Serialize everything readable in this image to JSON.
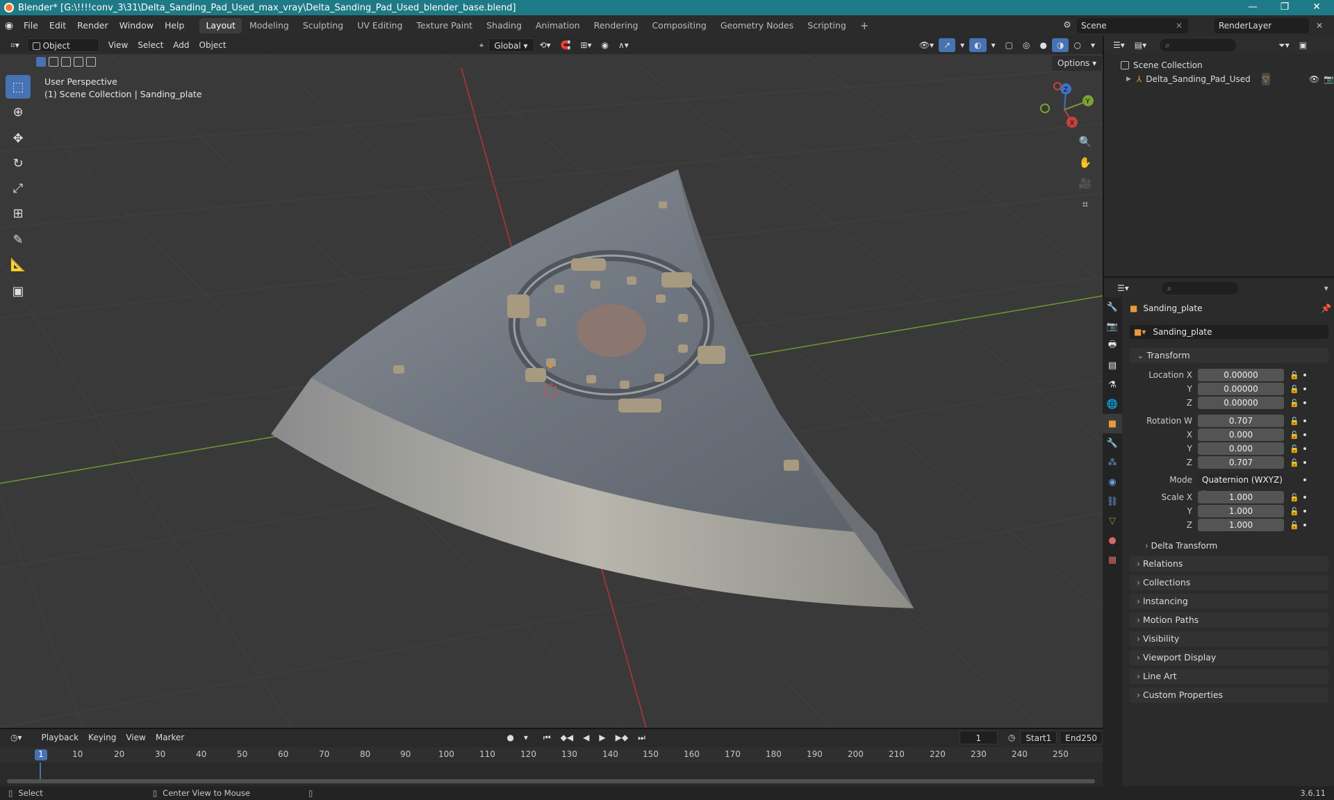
{
  "window": {
    "title": "Blender* [G:\\!!!!conv_3\\31\\Delta_Sanding_Pad_Used_max_vray\\Delta_Sanding_Pad_Used_blender_base.blend]",
    "controls": [
      "—",
      "❐",
      "✕"
    ]
  },
  "menu": [
    "File",
    "Edit",
    "Render",
    "Window",
    "Help"
  ],
  "workspaces": [
    "Layout",
    "Modeling",
    "Sculpting",
    "UV Editing",
    "Texture Paint",
    "Shading",
    "Animation",
    "Rendering",
    "Compositing",
    "Geometry Nodes",
    "Scripting"
  ],
  "active_workspace": "Layout",
  "scene_name": "Scene",
  "view_layer": "RenderLayer",
  "viewport_header": {
    "mode": "Object Mode",
    "menus": [
      "View",
      "Select",
      "Add",
      "Object"
    ],
    "orientation": "Global",
    "options_label": "Options"
  },
  "viewport": {
    "perspective": "User Perspective",
    "collection_info": "(1) Scene Collection | Sanding_plate",
    "gizmo": {
      "z": "Z",
      "y": "Y",
      "x": "X"
    }
  },
  "tools": [
    "select-box",
    "cursor",
    "move",
    "rotate",
    "scale",
    "transform",
    "annotate",
    "measure",
    "add-cube"
  ],
  "outliner": {
    "root": "Scene Collection",
    "items": [
      {
        "name": "Delta_Sanding_Pad_Used"
      }
    ]
  },
  "properties": {
    "object_name": "Sanding_plate",
    "data_name": "Sanding_plate",
    "transform_label": "Transform",
    "location": {
      "label": "Location X",
      "x": "0.00000",
      "y": "0.00000",
      "z": "0.00000"
    },
    "rotation": {
      "label": "Rotation W",
      "w": "0.707",
      "x": "0.000",
      "y": "0.000",
      "z": "0.707"
    },
    "mode_label": "Mode",
    "mode_value": "Quaternion (WXYZ)",
    "scale": {
      "label": "Scale X",
      "x": "1.000",
      "y": "1.000",
      "z": "1.000"
    },
    "axis_labels": {
      "y": "Y",
      "z": "Z",
      "x": "X"
    },
    "delta_transform": "Delta Transform",
    "panels": [
      "Relations",
      "Collections",
      "Instancing",
      "Motion Paths",
      "Visibility",
      "Viewport Display",
      "Line Art",
      "Custom Properties"
    ]
  },
  "timeline": {
    "menus": [
      "Playback",
      "Keying",
      "View",
      "Marker"
    ],
    "current_frame": "1",
    "start_label": "Start",
    "start": "1",
    "end_label": "End",
    "end": "250",
    "ruler": [
      "1",
      "10",
      "20",
      "30",
      "40",
      "50",
      "60",
      "70",
      "80",
      "90",
      "100",
      "110",
      "120",
      "130",
      "140",
      "150",
      "160",
      "170",
      "180",
      "190",
      "200",
      "210",
      "220",
      "230",
      "240",
      "250"
    ]
  },
  "statusbar": {
    "left": "Select",
    "middle": "Center View to Mouse",
    "version": "3.6.11"
  },
  "colors": {
    "titlebar": "#1e7a86",
    "accent": "#4772b3",
    "x_axis": "#b5353a",
    "y_axis": "#6f9a2f"
  }
}
